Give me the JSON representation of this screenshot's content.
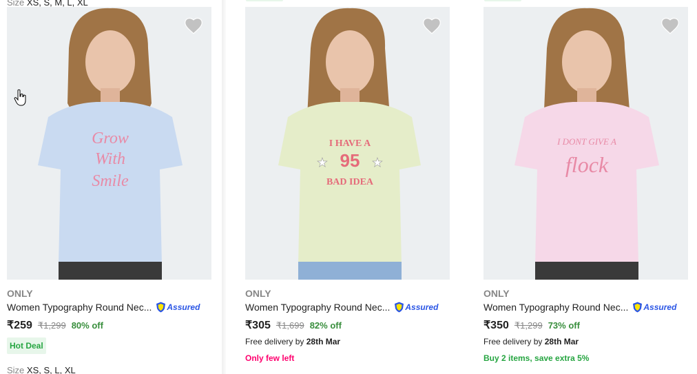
{
  "top": {
    "size_label": "Size",
    "size_values": "XS, S, M, L, XL"
  },
  "products": [
    {
      "brand": "ONLY",
      "title": "Women Typography Round Nec...",
      "assured": "Assured",
      "price": "₹259",
      "mrp": "₹1,299",
      "discount": "80% off",
      "badge": "Hot Deal",
      "size_label": "Size",
      "size_values": "XS, S, L, XL",
      "shirt_color": "#c9daf1",
      "print_color": "#e88aa6"
    },
    {
      "brand": "ONLY",
      "title": "Women Typography Round Nec...",
      "assured": "Assured",
      "price": "₹305",
      "mrp": "₹1,699",
      "discount": "82% off",
      "delivery_prefix": "Free delivery by",
      "delivery_date": "28th Mar",
      "extra": "Only few left",
      "extra_color": "#ff006e",
      "shirt_color": "#e5edc9",
      "print_color": "#e56b7a"
    },
    {
      "brand": "ONLY",
      "title": "Women Typography Round Nec...",
      "assured": "Assured",
      "price": "₹350",
      "mrp": "₹1,299",
      "discount": "73% off",
      "delivery_prefix": "Free delivery by",
      "delivery_date": "28th Mar",
      "extra": "Buy 2 items, save extra 5%",
      "extra_color": "#26a541",
      "shirt_color": "#f6d8e8",
      "print_color": "#e88aa6"
    }
  ],
  "icons": {
    "wishlist": "heart-icon",
    "assured": "assured-shield-icon",
    "cursor": "hand-pointer-icon"
  }
}
